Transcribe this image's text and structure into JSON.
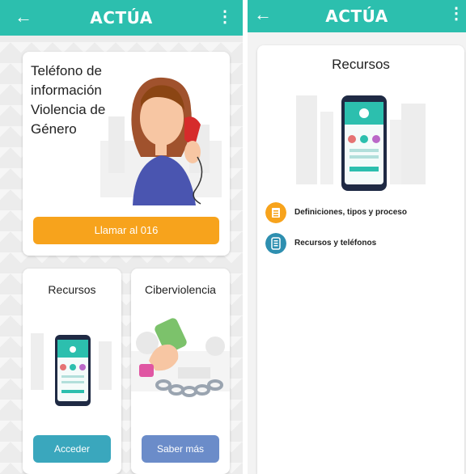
{
  "left_screen": {
    "appbar": {
      "back_icon": "arrow-left-icon",
      "title": "ACTÚA",
      "more_icon": "more-vertical-icon"
    },
    "phone_card": {
      "text": "Teléfono de información Violencia de Género",
      "button_label": "Llamar al 016",
      "button_color": "#f7a31c"
    },
    "recursos_card": {
      "title": "Recursos",
      "button_label": "Acceder",
      "button_color": "#3aa7bd"
    },
    "ciber_card": {
      "title": "Ciberviolencia",
      "button_label": "Saber más",
      "button_color": "#6b8cc9"
    }
  },
  "right_screen": {
    "appbar": {
      "back_icon": "arrow-left-icon",
      "title": "ACTÚA",
      "more_icon": "more-vertical-icon"
    },
    "panel_title": "Recursos",
    "items": [
      {
        "label": "Definiciones, tipos y proceso",
        "icon": "document-list-icon",
        "color": "#f7a31c"
      },
      {
        "label": "Recursos y teléfonos",
        "icon": "phone-book-icon",
        "color": "#2e8fb0"
      }
    ]
  },
  "colors": {
    "accent": "#2cbfae",
    "orange": "#f7a31c",
    "teal": "#3aa7bd"
  }
}
